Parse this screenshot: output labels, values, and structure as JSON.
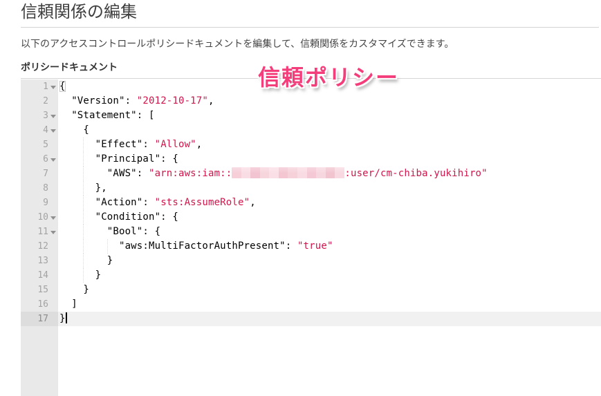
{
  "page": {
    "title": "信頼関係の編集",
    "description": "以下のアクセスコントロールポリシードキュメントを編集して、信頼関係をカスタマイズできます。",
    "policy_label": "ポリシードキュメント",
    "annotation": "信頼ポリシー"
  },
  "colors": {
    "string_token": "#d1154a",
    "annotation_pink": "#f43e7c",
    "gutter_bg": "#e9e9e9",
    "active_line_bg": "#f1f1f1",
    "redacted_pink": "#f6cfd9"
  },
  "editor": {
    "lines": [
      {
        "n": 1,
        "fold": true,
        "tokens": [
          {
            "t": "bracket",
            "v": "{"
          }
        ]
      },
      {
        "n": 2,
        "tokens": [
          {
            "t": "plain",
            "v": "  \"Version\": "
          },
          {
            "t": "string",
            "v": "\"2012-10-17\""
          },
          {
            "t": "plain",
            "v": ","
          }
        ]
      },
      {
        "n": 3,
        "fold": true,
        "tokens": [
          {
            "t": "plain",
            "v": "  \"Statement\": ["
          }
        ]
      },
      {
        "n": 4,
        "fold": true,
        "tokens": [
          {
            "t": "plain",
            "v": "    {"
          }
        ]
      },
      {
        "n": 5,
        "tokens": [
          {
            "t": "plain",
            "v": "      \"Effect\": "
          },
          {
            "t": "string",
            "v": "\"Allow\""
          },
          {
            "t": "plain",
            "v": ","
          }
        ]
      },
      {
        "n": 6,
        "fold": true,
        "tokens": [
          {
            "t": "plain",
            "v": "      \"Principal\": {"
          }
        ]
      },
      {
        "n": 7,
        "tokens": [
          {
            "t": "plain",
            "v": "        \"AWS\": "
          },
          {
            "t": "string",
            "v": "\"arn:aws:iam::"
          },
          {
            "t": "redacted",
            "v": ""
          },
          {
            "t": "string",
            "v": ":user/cm-chiba.yukihiro\""
          }
        ]
      },
      {
        "n": 8,
        "tokens": [
          {
            "t": "plain",
            "v": "      },"
          }
        ]
      },
      {
        "n": 9,
        "tokens": [
          {
            "t": "plain",
            "v": "      \"Action\": "
          },
          {
            "t": "string",
            "v": "\"sts:AssumeRole\""
          },
          {
            "t": "plain",
            "v": ","
          }
        ]
      },
      {
        "n": 10,
        "fold": true,
        "tokens": [
          {
            "t": "plain",
            "v": "      \"Condition\": {"
          }
        ]
      },
      {
        "n": 11,
        "fold": true,
        "tokens": [
          {
            "t": "plain",
            "v": "        \"Bool\": {"
          }
        ]
      },
      {
        "n": 12,
        "tokens": [
          {
            "t": "plain",
            "v": "          \"aws:MultiFactorAuthPresent\": "
          },
          {
            "t": "string",
            "v": "\"true\""
          }
        ]
      },
      {
        "n": 13,
        "tokens": [
          {
            "t": "plain",
            "v": "        }"
          }
        ]
      },
      {
        "n": 14,
        "tokens": [
          {
            "t": "plain",
            "v": "      }"
          }
        ]
      },
      {
        "n": 15,
        "tokens": [
          {
            "t": "plain",
            "v": "    }"
          }
        ]
      },
      {
        "n": 16,
        "tokens": [
          {
            "t": "plain",
            "v": "  ]"
          }
        ]
      },
      {
        "n": 17,
        "active": true,
        "caret": true,
        "tokens": [
          {
            "t": "plain",
            "v": "}"
          }
        ]
      }
    ]
  }
}
